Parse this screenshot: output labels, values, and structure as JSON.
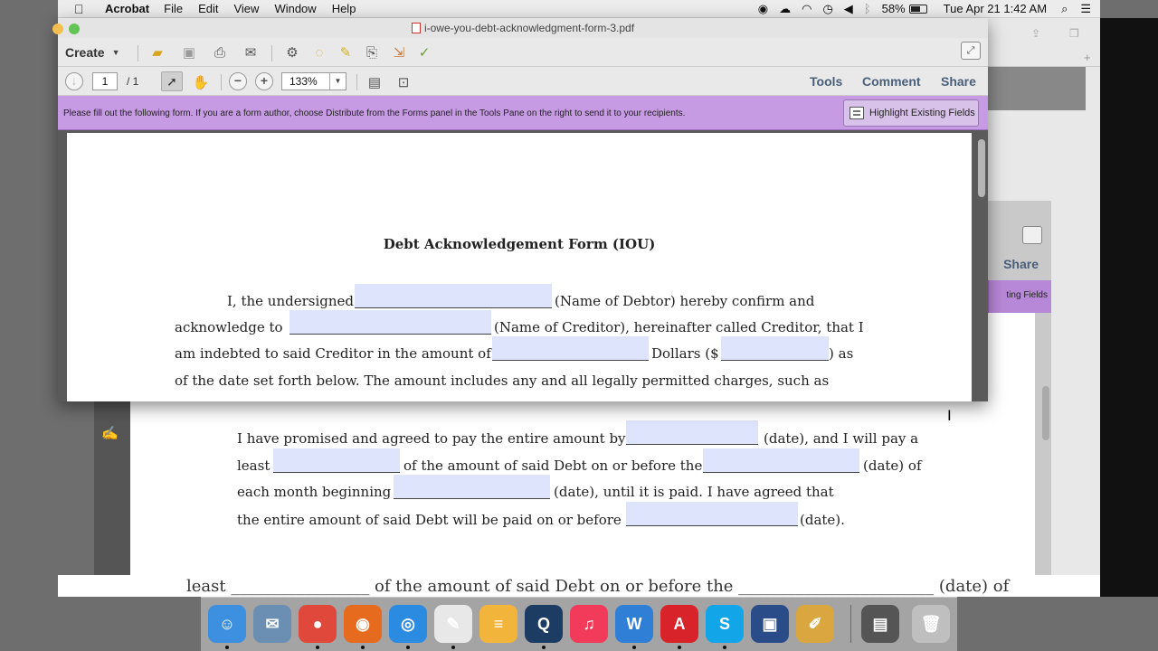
{
  "menubar": {
    "app_name": "Acrobat",
    "menus": [
      "File",
      "Edit",
      "View",
      "Window",
      "Help"
    ],
    "battery_percent": "58%",
    "battery_level": 0.58,
    "datetime": "Tue Apr 21  1:42 AM"
  },
  "window": {
    "title": "i-owe-you-debt-acknowledgment-form-3.pdf"
  },
  "toolbar": {
    "create_label": "Create",
    "page_current": "1",
    "page_total": "/  1",
    "zoom": "133%",
    "tools_label": "Tools",
    "comment_label": "Comment",
    "share_label": "Share"
  },
  "formbar": {
    "message": "Please fill out the following form. If you are a form author, choose Distribute from the Forms panel in the Tools Pane on the right to send it to your recipients.",
    "highlight_label": "Highlight Existing Fields"
  },
  "document": {
    "title": "Debt Acknowledgement Form (IOU)",
    "para1": {
      "l1a": "I, the undersigned ",
      "l1b": " (Name of Debtor) hereby confirm and",
      "l2a": "acknowledge to ",
      "l2b": " (Name of Creditor), hereinafter called Creditor, that I",
      "l3a": "am indebted to said Creditor in the amount of ",
      "l3b": " Dollars ($",
      "l3c": ") as",
      "l4": "of the date set forth below. The amount includes any and all legally permitted charges, such as"
    }
  },
  "back_window": {
    "share_label": "Share",
    "highlight_fragment": "ting Fields",
    "para2": {
      "l1a": "I have promised and agreed to pay the entire amount by ",
      "l1b": " (date), and I will pay a",
      "l2a": "least ",
      "l2b": " of the amount of said Debt on or before the ",
      "l2c": " (date) of",
      "l3a": "each month beginning ",
      "l3b": " (date), until it is paid. I have agreed that",
      "l4a": "the entire amount of said Debt will be paid on or before ",
      "l4b": "(date)."
    },
    "blur_line": "least _________________ of the amount of said Debt on or before the ________________________ (date) of"
  },
  "dock": {
    "apps": [
      {
        "name": "Finder",
        "glyph": "☺",
        "color": "#3d8fe0"
      },
      {
        "name": "Preview",
        "glyph": "✉",
        "color": "#6b8fb3"
      },
      {
        "name": "Chrome",
        "glyph": "●",
        "color": "#e0483b"
      },
      {
        "name": "Firefox",
        "glyph": "◉",
        "color": "#e66b1f"
      },
      {
        "name": "Safari",
        "glyph": "◎",
        "color": "#2b8be0"
      },
      {
        "name": "TextEdit",
        "glyph": "✎",
        "color": "#e8e8e8"
      },
      {
        "name": "Notes",
        "glyph": "≡",
        "color": "#f2b43a"
      },
      {
        "name": "QuickTime",
        "glyph": "Q",
        "color": "#1d3c63"
      },
      {
        "name": "iTunes",
        "glyph": "♫",
        "color": "#f23a5a"
      },
      {
        "name": "Word",
        "glyph": "W",
        "color": "#2f7fd6"
      },
      {
        "name": "Acrobat",
        "glyph": "A",
        "color": "#d8232a"
      },
      {
        "name": "Skype",
        "glyph": "S",
        "color": "#12a6e8"
      },
      {
        "name": "Screen",
        "glyph": "▣",
        "color": "#2a4d8a"
      },
      {
        "name": "Utility",
        "glyph": "✐",
        "color": "#d9a640"
      },
      {
        "name": "Documents",
        "glyph": "▤",
        "color": "#555555"
      },
      {
        "name": "Trash",
        "glyph": "🗑",
        "color": "#bfbfbf"
      }
    ]
  }
}
